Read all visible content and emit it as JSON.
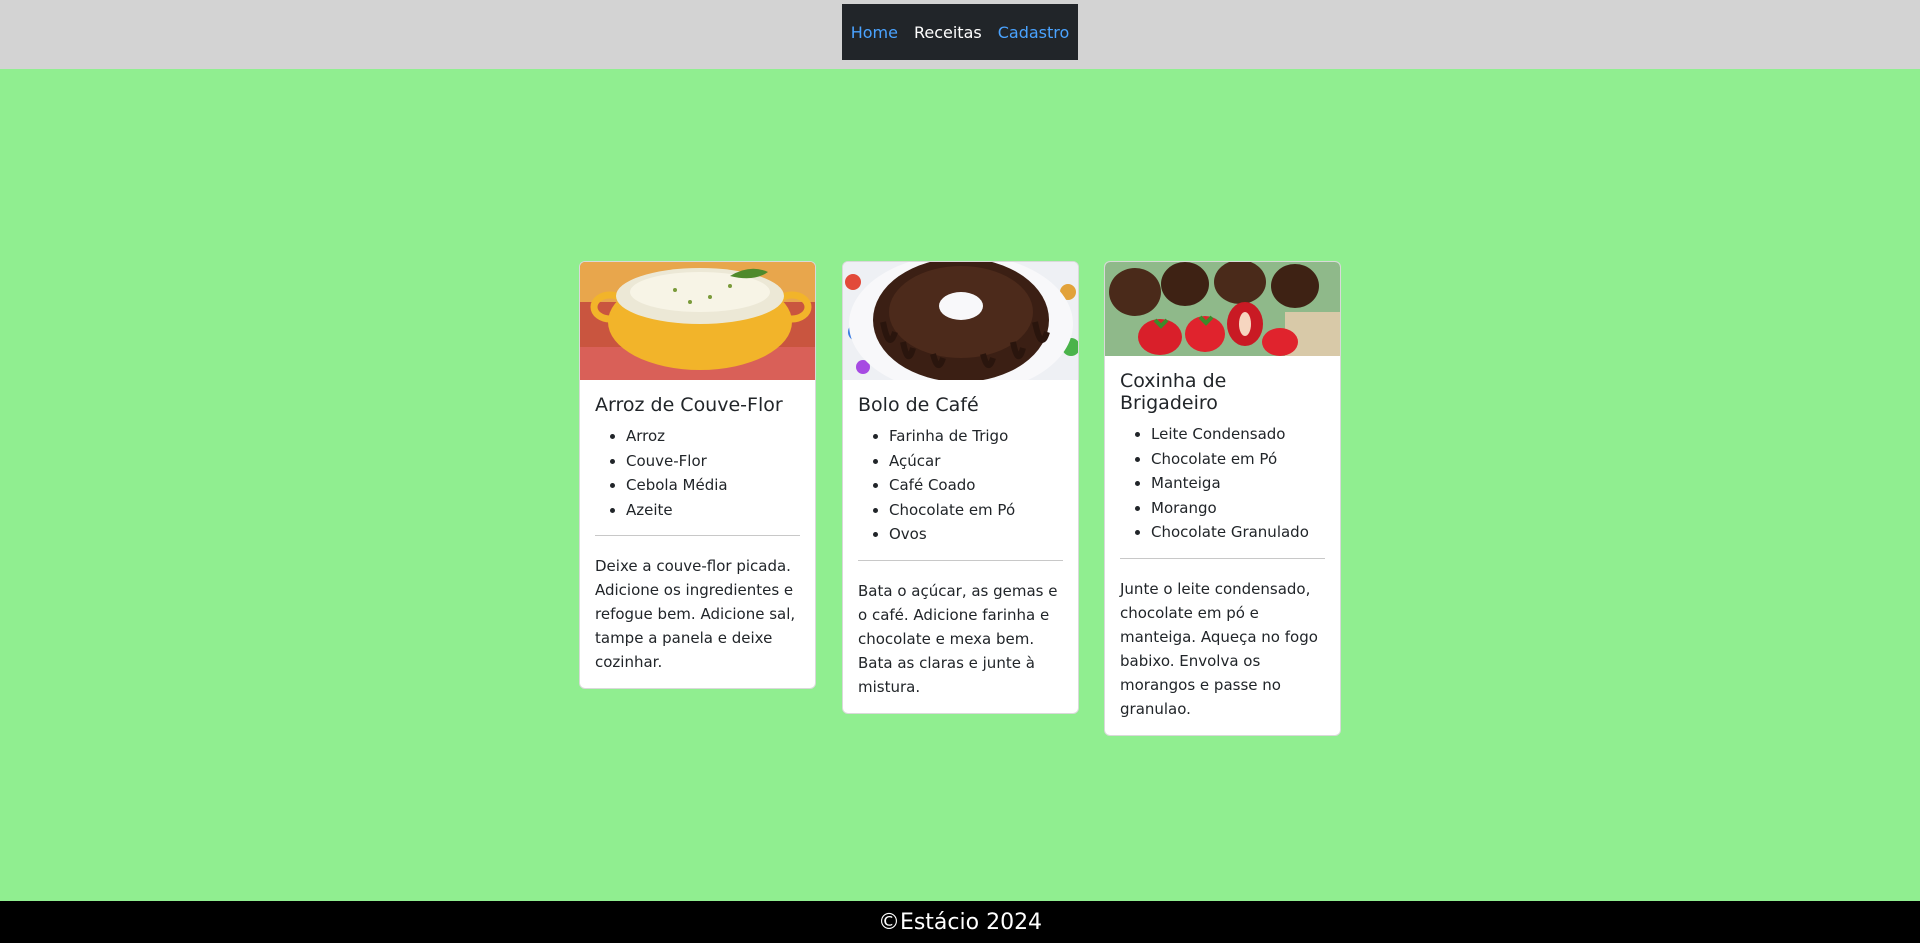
{
  "nav": {
    "items": [
      {
        "label": "Home",
        "active": false
      },
      {
        "label": "Receitas",
        "active": true
      },
      {
        "label": "Cadastro",
        "active": false
      }
    ]
  },
  "recipes": [
    {
      "title": "Arroz de Couve-Flor",
      "image_icon": "cauliflower-rice-photo",
      "ingredients": [
        "Arroz",
        "Couve-Flor",
        "Cebola Média",
        "Azeite"
      ],
      "instructions": "Deixe a couve-flor picada. Adicione os ingredientes e refogue bem. Adicione sal, tampe a panela e deixe cozinhar."
    },
    {
      "title": "Bolo de Café",
      "image_icon": "chocolate-bundt-cake-photo",
      "ingredients": [
        "Farinha de Trigo",
        "Açúcar",
        "Café Coado",
        "Chocolate em Pó",
        "Ovos"
      ],
      "instructions": "Bata o açúcar, as gemas e o café. Adicione farinha e chocolate e mexa bem. Bata as claras e junte à mistura."
    },
    {
      "title": "Coxinha de Brigadeiro",
      "image_icon": "strawberry-brigadeiro-photo",
      "ingredients": [
        "Leite Condensado",
        "Chocolate em Pó",
        "Manteiga",
        "Morango",
        "Chocolate Granulado"
      ],
      "instructions": "Junte o leite condensado, chocolate em pó e manteiga. Aqueça no fogo babixo. Envolva os morangos e passe no granulao."
    }
  ],
  "footer": {
    "text": "©Estácio 2024"
  },
  "colors": {
    "page_background": "#90ee90",
    "topbar_background": "#d3d3d3",
    "nav_background": "#212529",
    "nav_link": "#4aa3ff",
    "nav_active": "#ffffff",
    "footer_background": "#000000"
  }
}
